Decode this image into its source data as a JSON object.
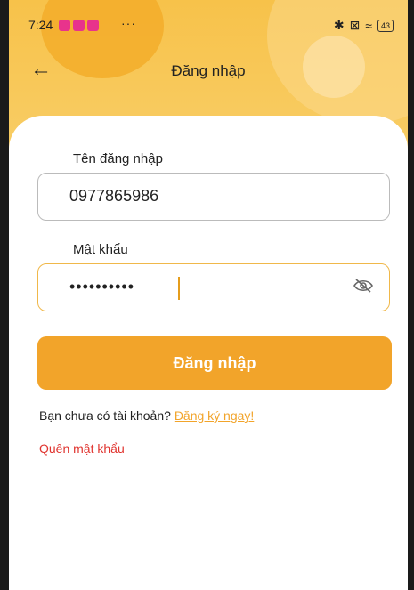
{
  "status_bar": {
    "time": "7:24",
    "more": "···",
    "battery": "43"
  },
  "header": {
    "back_icon": "←",
    "title": "Đăng nhập"
  },
  "form": {
    "username_label": "Tên đăng nhập",
    "username_value": "0977865986",
    "password_label": "Mật khẩu",
    "password_value": "••••••••••",
    "login_button": "Đăng nhập"
  },
  "footer": {
    "register_prompt": "Bạn chưa có tài khoản?",
    "register_link": "Đăng ký ngay!",
    "forgot_password": "Quên mật khẩu"
  },
  "colors": {
    "accent": "#f2a42a",
    "header": "#f7c24a",
    "error_link": "#e0342f"
  }
}
